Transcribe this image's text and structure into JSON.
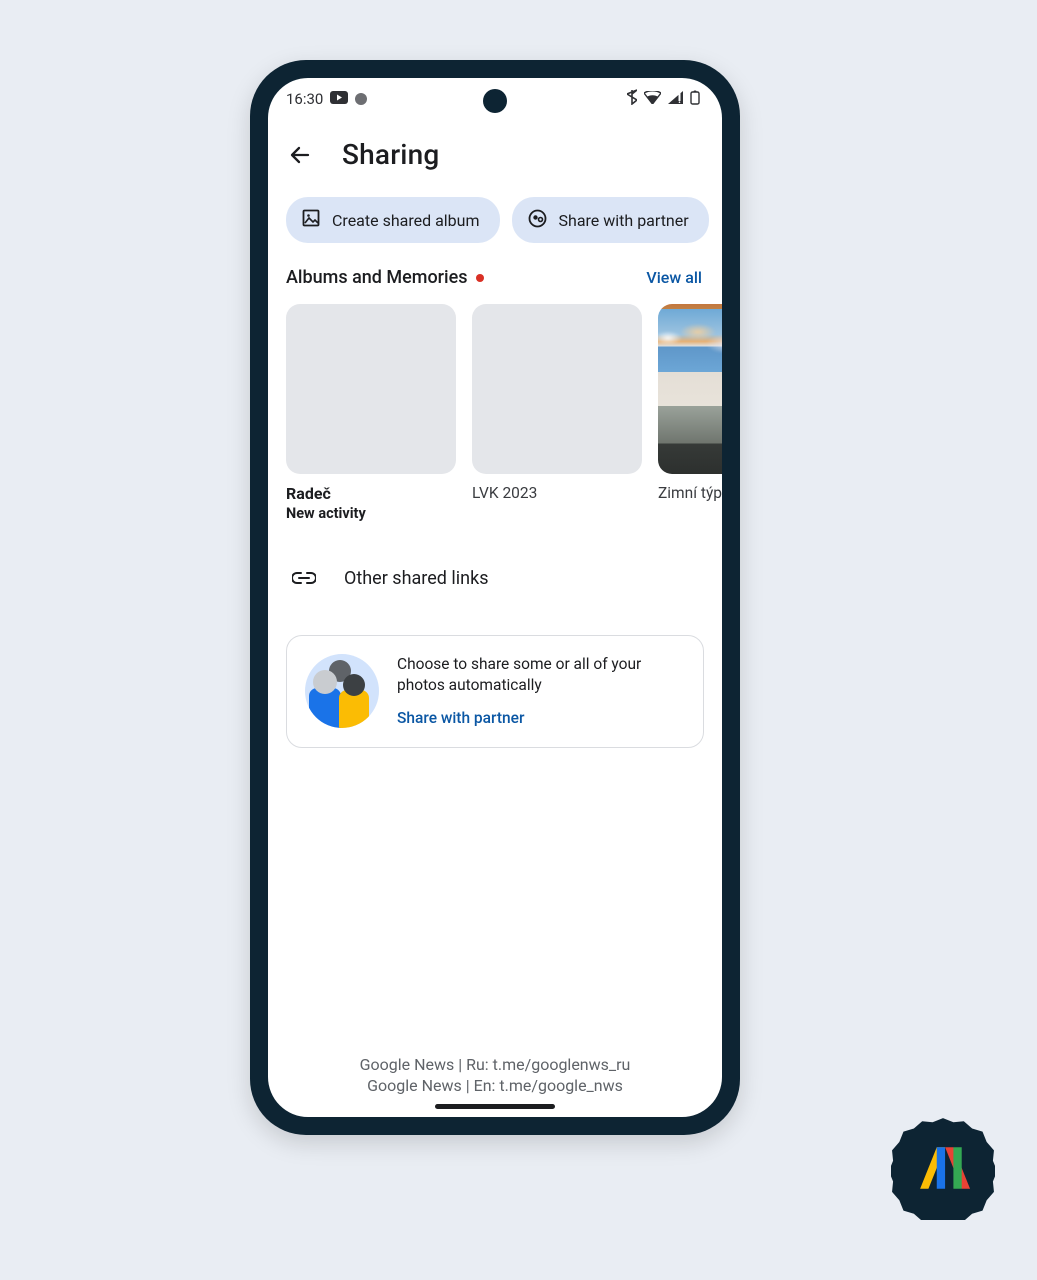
{
  "statusbar": {
    "time": "16:30"
  },
  "header": {
    "title": "Sharing"
  },
  "chips": {
    "create": "Create shared album",
    "partner": "Share with partner"
  },
  "section": {
    "title": "Albums and Memories",
    "view_all": "View all"
  },
  "albums": [
    {
      "title": "Radeč",
      "subtitle": "New activity"
    },
    {
      "title": "LVK 2023",
      "subtitle": ""
    },
    {
      "title": "Zimní týpka",
      "subtitle": ""
    }
  ],
  "other_links": {
    "label": "Other shared links"
  },
  "partner_card": {
    "text": "Choose to share some or all of your photos automatically",
    "link": "Share with partner"
  },
  "footer": {
    "line1": "Google News | Ru: t.me/googlenws_ru",
    "line2": "Google News | En: t.me/google_nws"
  }
}
